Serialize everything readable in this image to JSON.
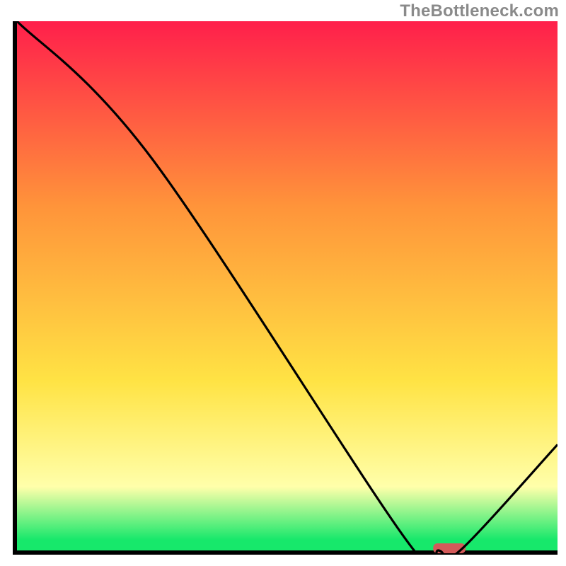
{
  "watermark": "TheBottleneck.com",
  "colors": {
    "red": "#ff1f4b",
    "orange": "#ff943a",
    "yellow": "#ffe344",
    "pale": "#ffffaa",
    "green": "#17e86b",
    "axis": "#000000",
    "curve": "#000000",
    "marker": "#d45a5a"
  },
  "chart_data": {
    "type": "line",
    "title": "",
    "xlabel": "",
    "ylabel": "",
    "xlim": [
      0,
      100
    ],
    "ylim": [
      0,
      100
    ],
    "x": [
      0,
      25,
      72,
      78,
      82,
      100
    ],
    "values": [
      100,
      74,
      2,
      0,
      0,
      20
    ],
    "marker": {
      "x_start": 77,
      "x_end": 83,
      "y": 0
    },
    "annotations": []
  }
}
